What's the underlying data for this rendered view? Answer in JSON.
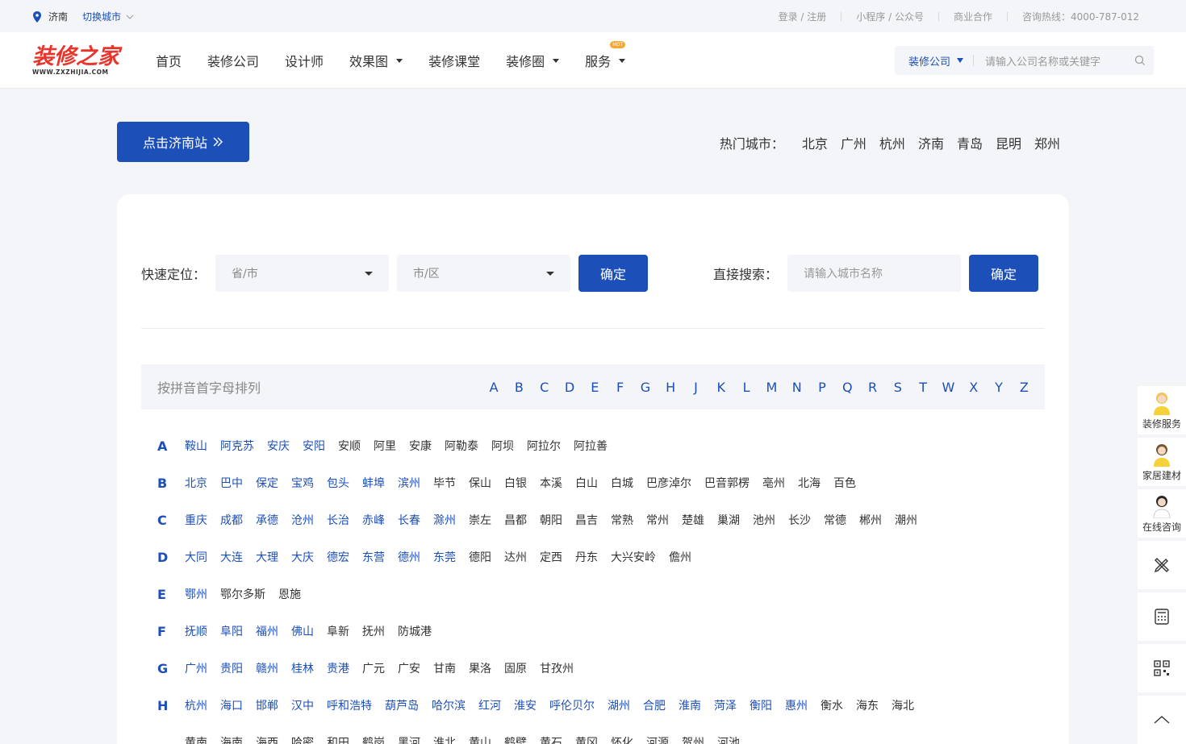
{
  "topbar": {
    "city": "济南",
    "switch_city": "切换城市",
    "links": [
      "登录 / 注册",
      "小程序 / 公众号",
      "商业合作",
      "咨询热线：4000-787-012"
    ]
  },
  "logo": {
    "brand": "装修之家",
    "url": "WWW.ZXZHIJIA.COM"
  },
  "nav": {
    "items": [
      "首页",
      "装修公司",
      "设计师",
      "效果图",
      "装修课堂",
      "装修圈",
      "服务"
    ],
    "hot_badge": "HOT"
  },
  "header_search": {
    "type": "装修公司",
    "placeholder": "请输入公司名称或关键字"
  },
  "station_button": "点击济南站",
  "hot_cities": {
    "label": "热门城市：",
    "cities": [
      "北京",
      "广州",
      "杭州",
      "济南",
      "青岛",
      "昆明",
      "郑州"
    ]
  },
  "quick_locate": {
    "label": "快速定位：",
    "province_placeholder": "省/市",
    "city_placeholder": "市/区",
    "confirm": "确定"
  },
  "direct_search": {
    "label": "直接搜索：",
    "placeholder": "请输入城市名称",
    "confirm": "确定"
  },
  "alphabet": {
    "label": "按拼音首字母排列",
    "letters": [
      "A",
      "B",
      "C",
      "D",
      "E",
      "F",
      "G",
      "H",
      "J",
      "K",
      "L",
      "M",
      "N",
      "P",
      "Q",
      "R",
      "S",
      "T",
      "W",
      "X",
      "Y",
      "Z"
    ]
  },
  "city_rows": [
    {
      "letter": "A",
      "cities": [
        {
          "n": "鞍山",
          "b": true
        },
        {
          "n": "阿克苏",
          "b": true
        },
        {
          "n": "安庆",
          "b": true
        },
        {
          "n": "安阳",
          "b": true
        },
        {
          "n": "安顺",
          "b": false
        },
        {
          "n": "阿里",
          "b": false
        },
        {
          "n": "安康",
          "b": false
        },
        {
          "n": "阿勒泰",
          "b": false
        },
        {
          "n": "阿坝",
          "b": false
        },
        {
          "n": "阿拉尔",
          "b": false
        },
        {
          "n": "阿拉善",
          "b": false
        }
      ]
    },
    {
      "letter": "B",
      "cities": [
        {
          "n": "北京",
          "b": true
        },
        {
          "n": "巴中",
          "b": true
        },
        {
          "n": "保定",
          "b": true
        },
        {
          "n": "宝鸡",
          "b": true
        },
        {
          "n": "包头",
          "b": true
        },
        {
          "n": "蚌埠",
          "b": true
        },
        {
          "n": "滨州",
          "b": true
        },
        {
          "n": "毕节",
          "b": false
        },
        {
          "n": "保山",
          "b": false
        },
        {
          "n": "白银",
          "b": false
        },
        {
          "n": "本溪",
          "b": false
        },
        {
          "n": "白山",
          "b": false
        },
        {
          "n": "白城",
          "b": false
        },
        {
          "n": "巴彦淖尔",
          "b": false
        },
        {
          "n": "巴音郭楞",
          "b": false
        },
        {
          "n": "亳州",
          "b": false
        },
        {
          "n": "北海",
          "b": false
        },
        {
          "n": "百色",
          "b": false
        }
      ]
    },
    {
      "letter": "C",
      "cities": [
        {
          "n": "重庆",
          "b": true
        },
        {
          "n": "成都",
          "b": true
        },
        {
          "n": "承德",
          "b": true
        },
        {
          "n": "沧州",
          "b": true
        },
        {
          "n": "长治",
          "b": true
        },
        {
          "n": "赤峰",
          "b": true
        },
        {
          "n": "长春",
          "b": true
        },
        {
          "n": "滁州",
          "b": true
        },
        {
          "n": "崇左",
          "b": false
        },
        {
          "n": "昌都",
          "b": false
        },
        {
          "n": "朝阳",
          "b": false
        },
        {
          "n": "昌吉",
          "b": false
        },
        {
          "n": "常熟",
          "b": false
        },
        {
          "n": "常州",
          "b": false
        },
        {
          "n": "楚雄",
          "b": false
        },
        {
          "n": "巢湖",
          "b": false
        },
        {
          "n": "池州",
          "b": false
        },
        {
          "n": "长沙",
          "b": false
        },
        {
          "n": "常德",
          "b": false
        },
        {
          "n": "郴州",
          "b": false
        },
        {
          "n": "潮州",
          "b": false
        }
      ]
    },
    {
      "letter": "D",
      "cities": [
        {
          "n": "大同",
          "b": true
        },
        {
          "n": "大连",
          "b": true
        },
        {
          "n": "大理",
          "b": true
        },
        {
          "n": "大庆",
          "b": true
        },
        {
          "n": "德宏",
          "b": true
        },
        {
          "n": "东营",
          "b": true
        },
        {
          "n": "德州",
          "b": true
        },
        {
          "n": "东莞",
          "b": true
        },
        {
          "n": "德阳",
          "b": false
        },
        {
          "n": "达州",
          "b": false
        },
        {
          "n": "定西",
          "b": false
        },
        {
          "n": "丹东",
          "b": false
        },
        {
          "n": "大兴安岭",
          "b": false
        },
        {
          "n": "儋州",
          "b": false
        }
      ]
    },
    {
      "letter": "E",
      "cities": [
        {
          "n": "鄂州",
          "b": true
        },
        {
          "n": "鄂尔多斯",
          "b": false
        },
        {
          "n": "恩施",
          "b": false
        }
      ]
    },
    {
      "letter": "F",
      "cities": [
        {
          "n": "抚顺",
          "b": true
        },
        {
          "n": "阜阳",
          "b": true
        },
        {
          "n": "福州",
          "b": true
        },
        {
          "n": "佛山",
          "b": true
        },
        {
          "n": "阜新",
          "b": false
        },
        {
          "n": "抚州",
          "b": false
        },
        {
          "n": "防城港",
          "b": false
        }
      ]
    },
    {
      "letter": "G",
      "cities": [
        {
          "n": "广州",
          "b": true
        },
        {
          "n": "贵阳",
          "b": true
        },
        {
          "n": "赣州",
          "b": true
        },
        {
          "n": "桂林",
          "b": true
        },
        {
          "n": "贵港",
          "b": true
        },
        {
          "n": "广元",
          "b": false
        },
        {
          "n": "广安",
          "b": false
        },
        {
          "n": "甘南",
          "b": false
        },
        {
          "n": "果洛",
          "b": false
        },
        {
          "n": "固原",
          "b": false
        },
        {
          "n": "甘孜州",
          "b": false
        }
      ]
    },
    {
      "letter": "H",
      "cities": [
        {
          "n": "杭州",
          "b": true
        },
        {
          "n": "海口",
          "b": true
        },
        {
          "n": "邯郸",
          "b": true
        },
        {
          "n": "汉中",
          "b": true
        },
        {
          "n": "呼和浩特",
          "b": true
        },
        {
          "n": "葫芦岛",
          "b": true
        },
        {
          "n": "哈尔滨",
          "b": true
        },
        {
          "n": "红河",
          "b": true
        },
        {
          "n": "淮安",
          "b": true
        },
        {
          "n": "呼伦贝尔",
          "b": true
        },
        {
          "n": "湖州",
          "b": true
        },
        {
          "n": "合肥",
          "b": true
        },
        {
          "n": "淮南",
          "b": true
        },
        {
          "n": "菏泽",
          "b": true
        },
        {
          "n": "衡阳",
          "b": true
        },
        {
          "n": "惠州",
          "b": true
        },
        {
          "n": "衡水",
          "b": false
        },
        {
          "n": "海东",
          "b": false
        },
        {
          "n": "海北",
          "b": false
        }
      ]
    },
    {
      "letter": "",
      "cities": [
        {
          "n": "黄南",
          "b": false
        },
        {
          "n": "海南",
          "b": false
        },
        {
          "n": "海西",
          "b": false
        },
        {
          "n": "哈密",
          "b": false
        },
        {
          "n": "和田",
          "b": false
        },
        {
          "n": "鹤岗",
          "b": false
        },
        {
          "n": "黑河",
          "b": false
        },
        {
          "n": "淮北",
          "b": false
        },
        {
          "n": "黄山",
          "b": false
        },
        {
          "n": "鹤壁",
          "b": false
        },
        {
          "n": "黄石",
          "b": false
        },
        {
          "n": "黄冈",
          "b": false
        },
        {
          "n": "怀化",
          "b": false
        },
        {
          "n": "河源",
          "b": false
        },
        {
          "n": "贺州",
          "b": false
        },
        {
          "n": "河池",
          "b": false
        }
      ]
    }
  ],
  "sidebar": {
    "items": [
      "装修服务",
      "家居建材",
      "在线咨询"
    ]
  },
  "colors": {
    "accent": "#1d4fb8",
    "brand_red": "#e8352b",
    "bg": "#f3f5f8"
  }
}
